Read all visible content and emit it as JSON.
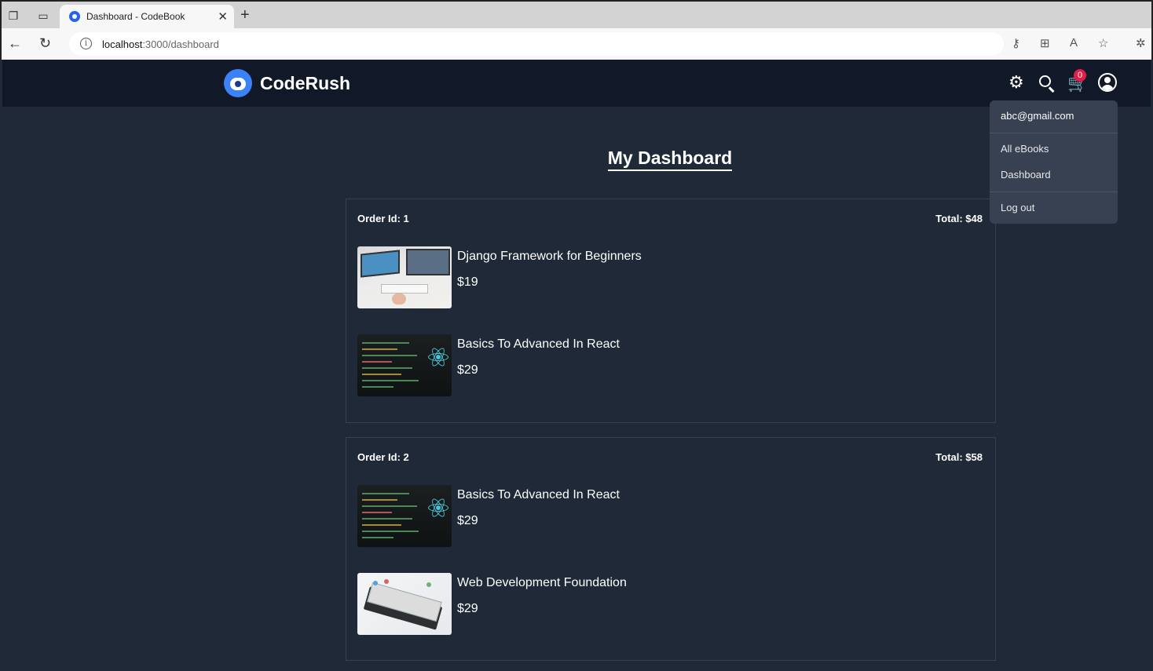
{
  "browser": {
    "tab_title": "Dashboard - CodeBook",
    "url_host": "localhost",
    "url_path": ":3000/dashboard"
  },
  "header": {
    "brand": "CodeRush",
    "cart_count": "0"
  },
  "user_menu": {
    "email": "abc@gmail.com",
    "items": [
      "All eBooks",
      "Dashboard",
      "Log out"
    ]
  },
  "page": {
    "title": "My Dashboard"
  },
  "orders": [
    {
      "id_label": "Order Id: 1",
      "total_label": "Total: $48",
      "items": [
        {
          "name": "Django Framework for Beginners",
          "price": "$19",
          "thumb": "django"
        },
        {
          "name": "Basics To Advanced In React",
          "price": "$29",
          "thumb": "react"
        }
      ]
    },
    {
      "id_label": "Order Id: 2",
      "total_label": "Total: $58",
      "items": [
        {
          "name": "Basics To Advanced In React",
          "price": "$29",
          "thumb": "react"
        },
        {
          "name": "Web Development Foundation",
          "price": "$29",
          "thumb": "web"
        }
      ]
    }
  ],
  "colors": {
    "page_bg": "#1f2937",
    "header_bg": "#111827",
    "dropdown_bg": "#374151",
    "badge": "#e11d48",
    "accent": "#3b82f6"
  }
}
